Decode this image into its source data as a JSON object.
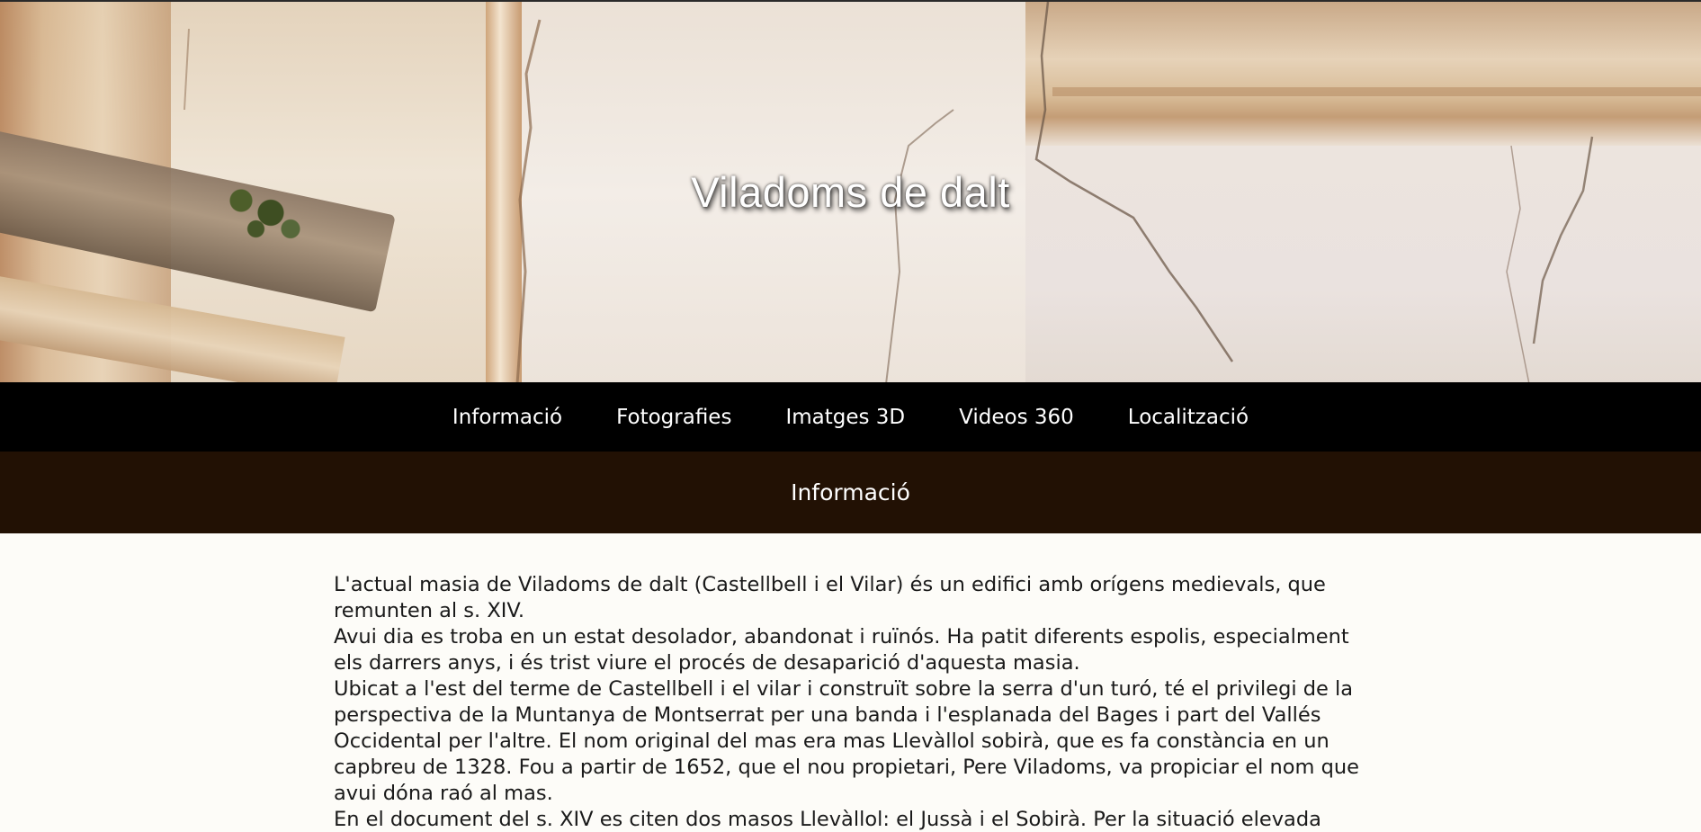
{
  "hero": {
    "title": "Viladoms de dalt"
  },
  "nav": {
    "items": [
      {
        "label": "Informació"
      },
      {
        "label": "Fotografies"
      },
      {
        "label": "Imatges 3D"
      },
      {
        "label": "Videos 360"
      },
      {
        "label": "Localització"
      }
    ]
  },
  "section": {
    "title": "Informació"
  },
  "content": {
    "paragraphs": [
      "L'actual masia de Viladoms de dalt (Castellbell i el Vilar) és un edifici amb orígens medievals, que remunten al s. XIV.",
      "Avui dia es troba en un estat desolador, abandonat i ruïnós. Ha patit diferents espolis, especialment els darrers anys, i és trist viure el procés de desaparició d'aquesta masia.",
      "Ubicat a l'est del terme de Castellbell i el vilar i construït sobre la serra d'un turó, té el privilegi de la perspectiva de la Muntanya de Montserrat per una banda i l'esplanada del Bages i part del Vallés Occidental per l'altre. El nom original del mas era mas Llevàllol sobirà, que es fa constància en un capbreu de 1328. Fou a partir de 1652, que el nou propietari, Pere Viladoms, va propiciar el nom que avui dóna raó al mas.",
      "En el document del s. XIV es citen dos masos Llevàllol: el Jussà i el Sobirà. Per la situació elevada"
    ]
  }
}
